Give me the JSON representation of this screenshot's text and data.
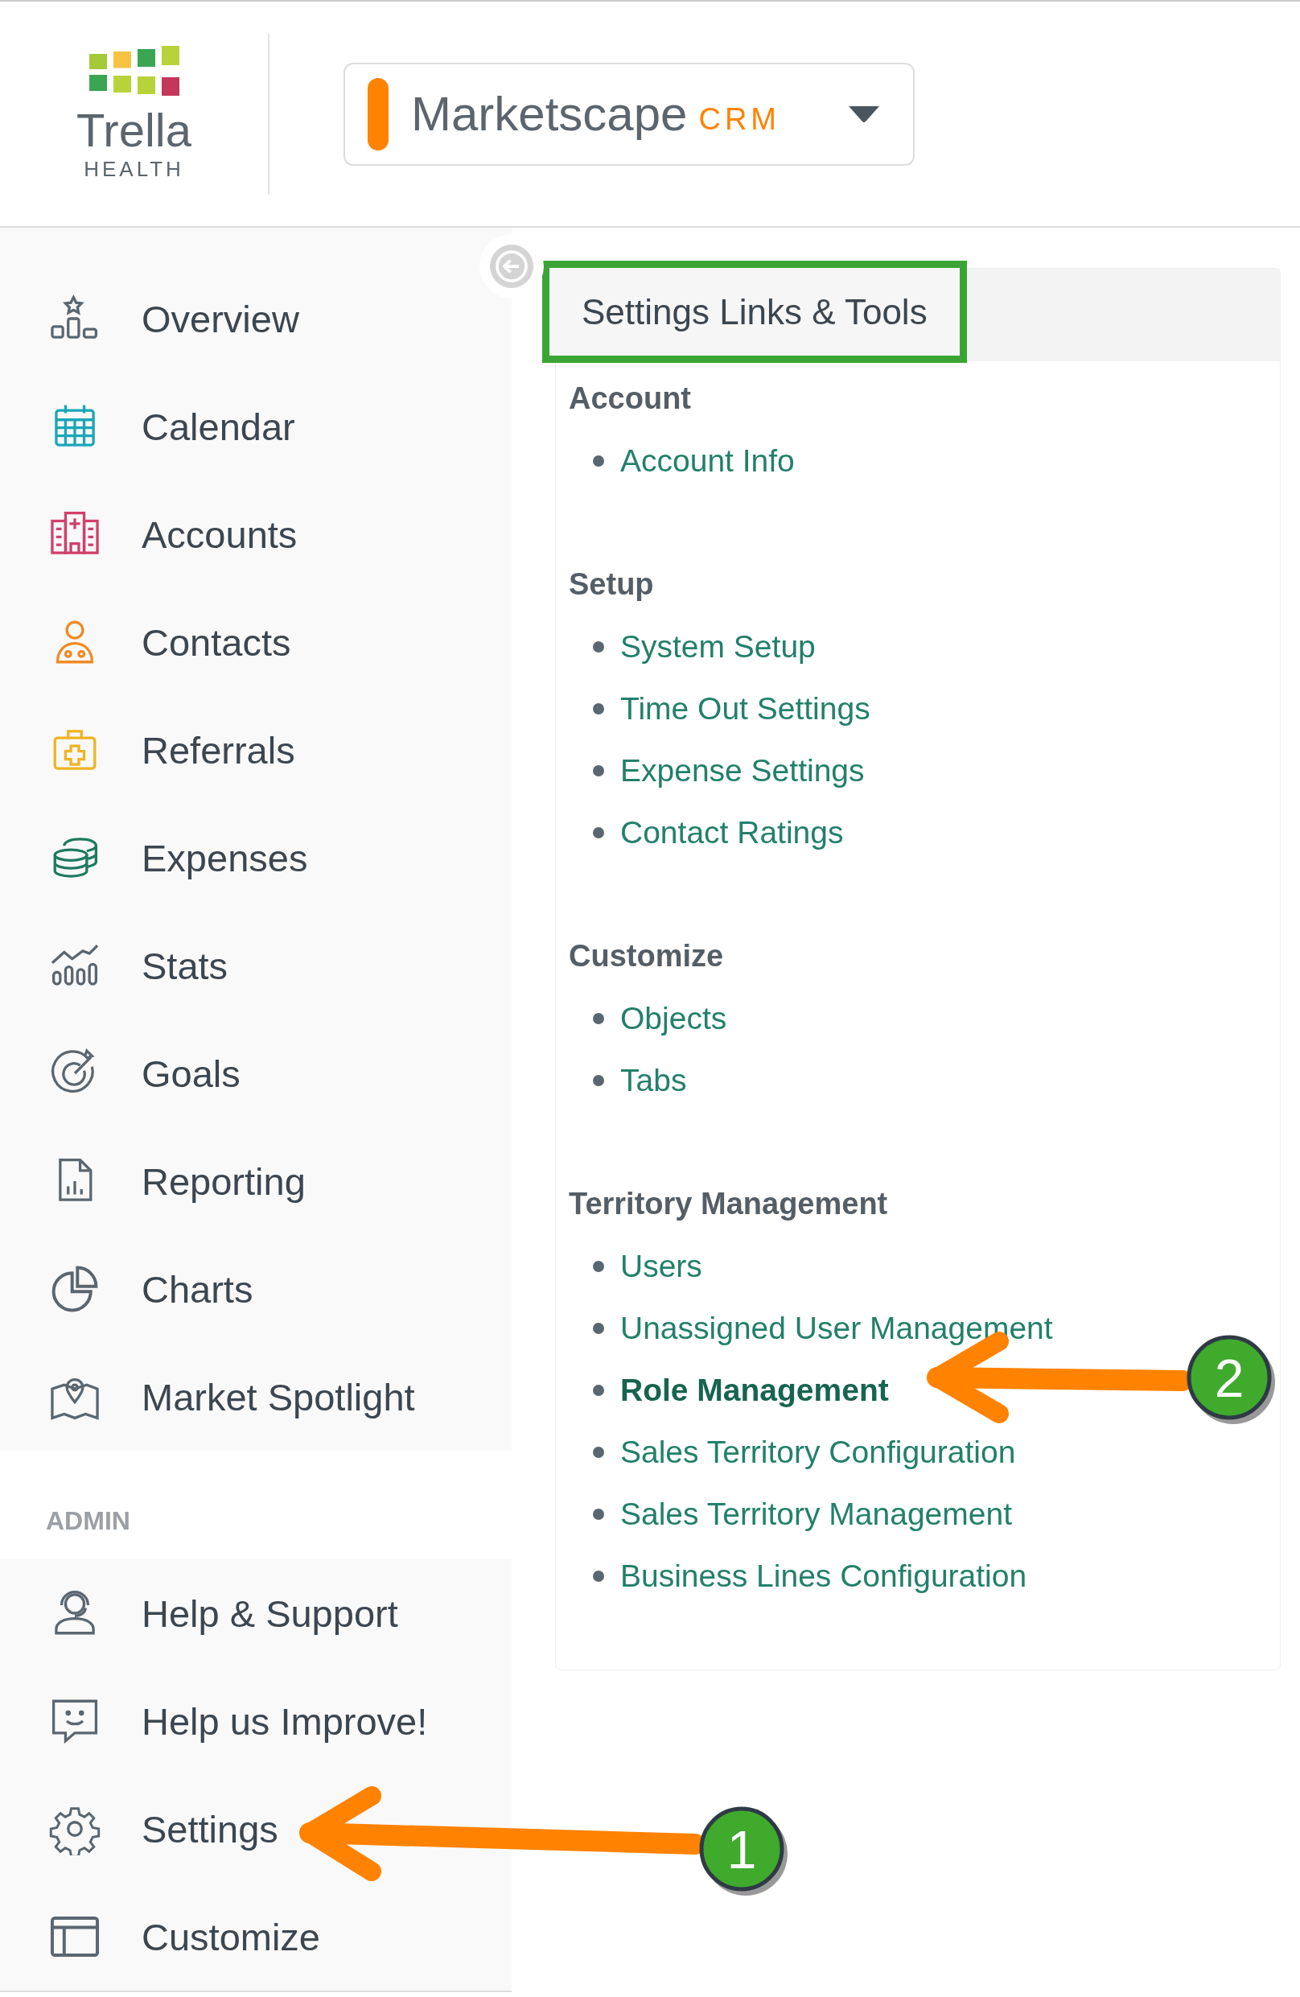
{
  "logo": {
    "name": "Trella",
    "tagline": "HEALTH"
  },
  "product_switcher": {
    "name": "Marketscape",
    "suffix": "CRM"
  },
  "sidebar": {
    "items": [
      {
        "label": "Overview",
        "selected": false
      },
      {
        "label": "Calendar",
        "selected": false
      },
      {
        "label": "Accounts",
        "selected": false
      },
      {
        "label": "Contacts",
        "selected": false
      },
      {
        "label": "Referrals",
        "selected": false
      },
      {
        "label": "Expenses",
        "selected": false
      },
      {
        "label": "Stats",
        "selected": false
      },
      {
        "label": "Goals",
        "selected": false
      },
      {
        "label": "Reporting",
        "selected": false
      },
      {
        "label": "Charts",
        "selected": false
      },
      {
        "label": "Market Spotlight",
        "selected": false
      }
    ],
    "admin_heading": "ADMIN",
    "admin_items": [
      {
        "label": "Help & Support",
        "selected": false
      },
      {
        "label": "Help us Improve!",
        "selected": false
      },
      {
        "label": "Settings",
        "selected": false
      },
      {
        "label": "Customize",
        "selected": false
      }
    ]
  },
  "panel": {
    "title": "Settings Links & Tools",
    "sections": [
      {
        "heading": "Account",
        "links": [
          {
            "label": "Account Info",
            "selected": false
          }
        ]
      },
      {
        "heading": "Setup",
        "links": [
          {
            "label": "System Setup",
            "selected": false
          },
          {
            "label": "Time Out Settings",
            "selected": false
          },
          {
            "label": "Expense Settings",
            "selected": false
          },
          {
            "label": "Contact Ratings",
            "selected": false
          }
        ]
      },
      {
        "heading": "Customize",
        "links": [
          {
            "label": "Objects",
            "selected": false
          },
          {
            "label": "Tabs",
            "selected": false
          }
        ]
      },
      {
        "heading": "Territory Management",
        "links": [
          {
            "label": "Users",
            "selected": false
          },
          {
            "label": "Unassigned User Management",
            "selected": false
          },
          {
            "label": "Role Management",
            "selected": true
          },
          {
            "label": "Sales Territory Configuration",
            "selected": false
          },
          {
            "label": "Sales Territory Management",
            "selected": false
          },
          {
            "label": "Business Lines Configuration",
            "selected": false
          }
        ]
      }
    ]
  },
  "annotations": [
    {
      "number": "1"
    },
    {
      "number": "2"
    }
  ]
}
